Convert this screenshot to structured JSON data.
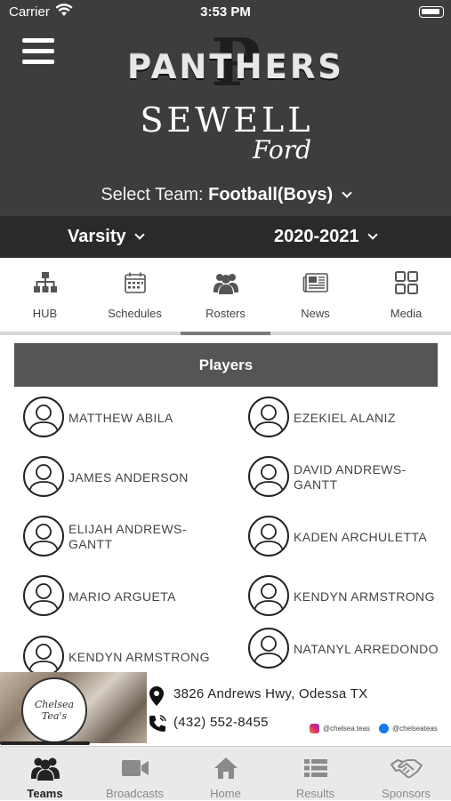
{
  "status_bar": {
    "carrier": "Carrier",
    "time": "3:53 PM"
  },
  "header": {
    "logo_text": "PANTHERS",
    "logo_letter": "P",
    "sponsor_name": "SEWELL",
    "sponsor_brand": "Ford",
    "select_team_label": "Select Team:",
    "selected_team": "Football(Boys)",
    "level": "Varsity",
    "season": "2020-2021"
  },
  "tabs": [
    {
      "label": "HUB",
      "icon": "org-chart-icon"
    },
    {
      "label": "Schedules",
      "icon": "calendar-icon"
    },
    {
      "label": "Rosters",
      "icon": "group-icon"
    },
    {
      "label": "News",
      "icon": "newspaper-icon"
    },
    {
      "label": "Media",
      "icon": "grid-icon"
    }
  ],
  "active_tab": "Rosters",
  "roster": {
    "section_title": "Players",
    "players": [
      "MATTHEW ABILA",
      "EZEKIEL ALANIZ",
      "JAMES ANDERSON",
      "DAVID ANDREWS-GANTT",
      "ELIJAH ANDREWS-GANTT",
      "KADEN ARCHULETTA",
      "MARIO ARGUETA",
      "KENDYN ARMSTRONG",
      "KENDYN ARMSTRONG",
      "NATANYL ARREDONDO"
    ]
  },
  "ad": {
    "logo_text": "Chelsea Tea's",
    "address": "3826 Andrews Hwy, Odessa TX",
    "phone": "(432) 552-8455",
    "instagram": "@chelsea.teas",
    "facebook": "@chelseateas"
  },
  "bottom_nav": [
    {
      "label": "Teams",
      "icon": "teams-icon"
    },
    {
      "label": "Broadcasts",
      "icon": "video-camera-icon"
    },
    {
      "label": "Home",
      "icon": "home-icon"
    },
    {
      "label": "Results",
      "icon": "list-icon"
    },
    {
      "label": "Sponsors",
      "icon": "handshake-icon"
    }
  ],
  "active_bottom_tab": "Teams",
  "colors": {
    "header_bg": "#3d3d3d",
    "subbar_bg": "#2a2a2a",
    "section_header_bg": "#555555",
    "bottom_bar_bg": "#e9e9e9"
  }
}
